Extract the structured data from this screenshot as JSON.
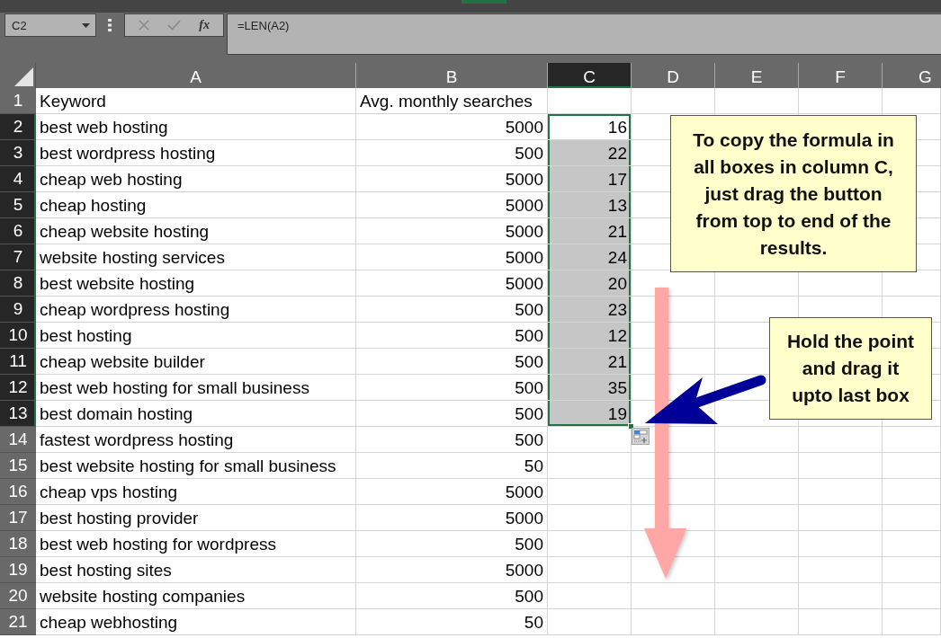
{
  "name_box": {
    "value": "C2"
  },
  "formula_buttons": [
    {
      "kind": "cancel",
      "disabled": true
    },
    {
      "kind": "enter",
      "disabled": true
    },
    {
      "kind": "function",
      "label": "fx",
      "disabled": false
    }
  ],
  "formula_bar": {
    "value": "=LEN(A2)"
  },
  "columns": [
    {
      "label": "A",
      "selected": false
    },
    {
      "label": "B",
      "selected": false
    },
    {
      "label": "C",
      "selected": true
    },
    {
      "label": "D",
      "selected": false
    },
    {
      "label": "E",
      "selected": false
    },
    {
      "label": "F",
      "selected": false
    },
    {
      "label": "G",
      "selected": false
    }
  ],
  "rows": [
    {
      "number": "1",
      "selected": false,
      "cells": [
        {
          "text": "Keyword",
          "kind": "text",
          "selected": false
        },
        {
          "text": "Avg. monthly searches",
          "kind": "text",
          "selected": false
        }
      ]
    },
    {
      "number": "2",
      "selected": true,
      "cells": [
        {
          "text": "best web hosting",
          "kind": "text",
          "selected": false
        },
        {
          "text": "5000",
          "kind": "number",
          "selected": false
        },
        {
          "text": "16",
          "kind": "number",
          "selected": true
        }
      ]
    },
    {
      "number": "3",
      "selected": true,
      "cells": [
        {
          "text": "best wordpress hosting",
          "kind": "text",
          "selected": false
        },
        {
          "text": "500",
          "kind": "number",
          "selected": false
        },
        {
          "text": "22",
          "kind": "number",
          "selected": true
        }
      ]
    },
    {
      "number": "4",
      "selected": true,
      "cells": [
        {
          "text": "cheap web hosting",
          "kind": "text",
          "selected": false
        },
        {
          "text": "5000",
          "kind": "number",
          "selected": false
        },
        {
          "text": "17",
          "kind": "number",
          "selected": true
        }
      ]
    },
    {
      "number": "5",
      "selected": true,
      "cells": [
        {
          "text": "cheap hosting",
          "kind": "text",
          "selected": false
        },
        {
          "text": "5000",
          "kind": "number",
          "selected": false
        },
        {
          "text": "13",
          "kind": "number",
          "selected": true
        }
      ]
    },
    {
      "number": "6",
      "selected": true,
      "cells": [
        {
          "text": "cheap website hosting",
          "kind": "text",
          "selected": false
        },
        {
          "text": "5000",
          "kind": "number",
          "selected": false
        },
        {
          "text": "21",
          "kind": "number",
          "selected": true
        }
      ]
    },
    {
      "number": "7",
      "selected": true,
      "cells": [
        {
          "text": "website hosting services",
          "kind": "text",
          "selected": false
        },
        {
          "text": "5000",
          "kind": "number",
          "selected": false
        },
        {
          "text": "24",
          "kind": "number",
          "selected": true
        }
      ]
    },
    {
      "number": "8",
      "selected": true,
      "cells": [
        {
          "text": "best website hosting",
          "kind": "text",
          "selected": false
        },
        {
          "text": "5000",
          "kind": "number",
          "selected": false
        },
        {
          "text": "20",
          "kind": "number",
          "selected": true
        }
      ]
    },
    {
      "number": "9",
      "selected": true,
      "cells": [
        {
          "text": "cheap wordpress hosting",
          "kind": "text",
          "selected": false
        },
        {
          "text": "500",
          "kind": "number",
          "selected": false
        },
        {
          "text": "23",
          "kind": "number",
          "selected": true
        }
      ]
    },
    {
      "number": "10",
      "selected": true,
      "cells": [
        {
          "text": "best hosting",
          "kind": "text",
          "selected": false
        },
        {
          "text": "500",
          "kind": "number",
          "selected": false
        },
        {
          "text": "12",
          "kind": "number",
          "selected": true
        }
      ]
    },
    {
      "number": "11",
      "selected": true,
      "cells": [
        {
          "text": "cheap website builder",
          "kind": "text",
          "selected": false
        },
        {
          "text": "500",
          "kind": "number",
          "selected": false
        },
        {
          "text": "21",
          "kind": "number",
          "selected": true
        }
      ]
    },
    {
      "number": "12",
      "selected": true,
      "cells": [
        {
          "text": "best web hosting for small business",
          "kind": "text",
          "selected": false
        },
        {
          "text": "500",
          "kind": "number",
          "selected": false
        },
        {
          "text": "35",
          "kind": "number",
          "selected": true
        }
      ]
    },
    {
      "number": "13",
      "selected": true,
      "cells": [
        {
          "text": "best domain hosting",
          "kind": "text",
          "selected": false
        },
        {
          "text": "500",
          "kind": "number",
          "selected": false
        },
        {
          "text": "19",
          "kind": "number",
          "selected": true
        }
      ]
    },
    {
      "number": "14",
      "selected": false,
      "cells": [
        {
          "text": "fastest wordpress hosting",
          "kind": "text",
          "selected": false
        },
        {
          "text": "500",
          "kind": "number",
          "selected": false
        }
      ]
    },
    {
      "number": "15",
      "selected": false,
      "cells": [
        {
          "text": "best website hosting for small business",
          "kind": "text",
          "selected": false
        },
        {
          "text": "50",
          "kind": "number",
          "selected": false
        }
      ]
    },
    {
      "number": "16",
      "selected": false,
      "cells": [
        {
          "text": "cheap vps hosting",
          "kind": "text",
          "selected": false
        },
        {
          "text": "5000",
          "kind": "number",
          "selected": false
        }
      ]
    },
    {
      "number": "17",
      "selected": false,
      "cells": [
        {
          "text": "best hosting provider",
          "kind": "text",
          "selected": false
        },
        {
          "text": "5000",
          "kind": "number",
          "selected": false
        }
      ]
    },
    {
      "number": "18",
      "selected": false,
      "cells": [
        {
          "text": "best web hosting for wordpress",
          "kind": "text",
          "selected": false
        },
        {
          "text": "500",
          "kind": "number",
          "selected": false
        }
      ]
    },
    {
      "number": "19",
      "selected": false,
      "cells": [
        {
          "text": "best hosting sites",
          "kind": "text",
          "selected": false
        },
        {
          "text": "5000",
          "kind": "number",
          "selected": false
        }
      ]
    },
    {
      "number": "20",
      "selected": false,
      "cells": [
        {
          "text": "website hosting companies",
          "kind": "text",
          "selected": false
        },
        {
          "text": "500",
          "kind": "number",
          "selected": false
        }
      ]
    },
    {
      "number": "21",
      "selected": false,
      "cells": [
        {
          "text": "cheap webhosting",
          "kind": "text",
          "selected": false
        },
        {
          "text": "50",
          "kind": "number",
          "selected": false
        }
      ]
    }
  ],
  "callouts": [
    {
      "text": "To copy the formula in all boxes in column C, just drag the button from top to end of the results."
    },
    {
      "text": "Hold the point and drag it upto last box"
    }
  ]
}
